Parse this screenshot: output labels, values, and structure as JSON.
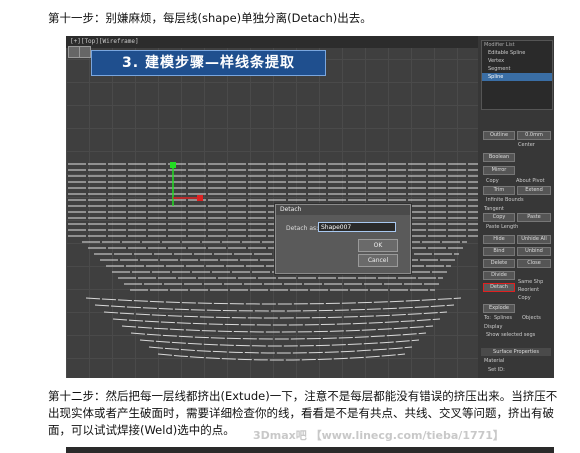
{
  "step11_text": "第十一步：别嫌麻烦，每层线(shape)单独分离(Detach)出去。",
  "step12_text": "第十二步：然后把每一层线都挤出(Extude)一下，注意不是每层都能没有错误的挤压出来。当挤压不出现实体或者产生破面时，需要详细检查你的线，看看是不是有共点、共线、交叉等问题，挤出有破面，可以试试焊接(Weld)选中的点。",
  "watermark": "3Dmax吧 【www.linecg.com/tieba/1771】",
  "banner_title": "3. 建模步骤—样线条提取",
  "viewport": {
    "label": "[+][Top][Wireframe]"
  },
  "modifier_stack": {
    "header": "Modifier List",
    "items": [
      {
        "label": "Editable Spline",
        "selected": false
      },
      {
        "label": "Vertex",
        "selected": false
      },
      {
        "label": "Segment",
        "selected": false
      },
      {
        "label": "Spline",
        "selected": true
      }
    ]
  },
  "geometry_panel": {
    "outline_label": "Outline",
    "outline_value": "0.0mm",
    "center_label": "Center",
    "boolean_label": "Boolean",
    "mirror_label": "Mirror",
    "copy_label": "Copy",
    "about_pivot_label": "About Pivot",
    "trim_label": "Trim",
    "extend_label": "Extend",
    "infinite_bounds_label": "Infinite Bounds",
    "tangent_label": "Tangent",
    "copy_btn": "Copy",
    "paste_btn": "Paste",
    "paste_length_label": "Paste Length",
    "hide_btn": "Hide",
    "unhide_all_btn": "Unhide All",
    "bind_btn": "Bind",
    "unbind_btn": "Unbind",
    "delete_btn": "Delete",
    "close_btn": "Close",
    "divide_btn": "Divide",
    "detach_btn": "Detach",
    "same_shp_label": "Same Shp",
    "reorient_label": "Reorient",
    "copy_check_label": "Copy",
    "explode_btn": "Explode",
    "to_label": "To:",
    "splines_label": "Splines",
    "objects_label": "Objects",
    "display_label": "Display",
    "show_selected_segs_label": "Show selected segs",
    "surface_properties_label": "Surface Properties",
    "material_label": "Material",
    "set_id_label": "Set ID:"
  },
  "detach_dialog": {
    "title": "Detach",
    "label": "Detach as:",
    "value": "Shape007",
    "ok": "OK",
    "cancel": "Cancel"
  },
  "colors": {
    "accent_blue": "#1f4f8e",
    "highlight_red": "#e02020",
    "spline_white": "#ffffff"
  }
}
